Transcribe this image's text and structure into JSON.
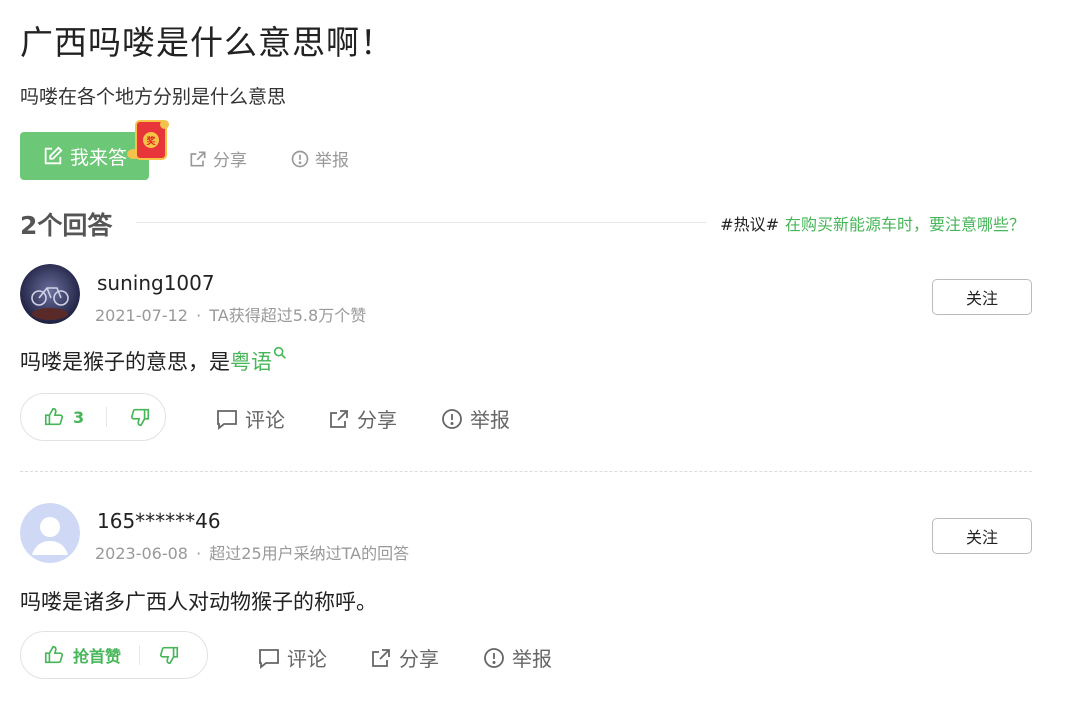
{
  "question": {
    "title": "广西吗喽是什么意思啊！",
    "description": "吗喽在各个地方分别是什么意思"
  },
  "actions": {
    "answer_label": "我来答",
    "redpacket_text": "奖",
    "share_label": "分享",
    "report_label": "举报"
  },
  "answers_header": {
    "count_label": "2个回答",
    "hot_tag": "#热议#",
    "hot_link": "在购买新能源车时，要注意哪些？"
  },
  "answers": [
    {
      "username": "suning1007",
      "date": "2021-07-12",
      "separator": "·",
      "badge": "TA获得超过5.8万个赞",
      "follow_label": "关注",
      "text_before": "吗喽是猴子的意思，是",
      "keyword": "粤语",
      "text_after": "",
      "likes": "3",
      "comment_label": "评论",
      "share_label": "分享",
      "report_label": "举报"
    },
    {
      "username": "165******46",
      "date": "2023-06-08",
      "separator": "·",
      "badge": "超过25用户采纳过TA的回答",
      "follow_label": "关注",
      "text": "吗喽是诸多广西人对动物猴子的称呼。",
      "likes": "抢首赞",
      "comment_label": "评论",
      "share_label": "分享",
      "report_label": "举报"
    }
  ],
  "colors": {
    "accent_green": "#6cc776",
    "link_green": "#47b658",
    "muted": "#999999"
  }
}
